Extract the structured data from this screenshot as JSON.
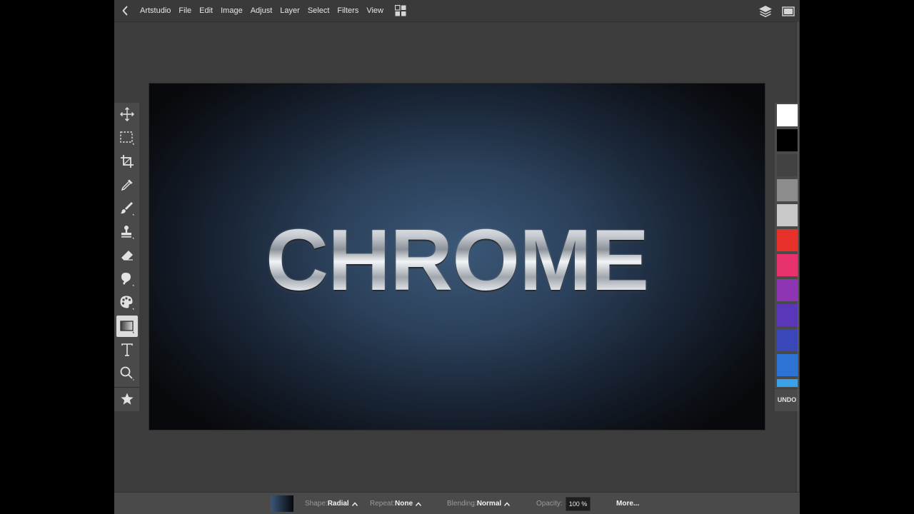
{
  "menubar": {
    "app_name": "Artstudio",
    "items": [
      "File",
      "Edit",
      "Image",
      "Adjust",
      "Layer",
      "Select",
      "Filters",
      "View"
    ],
    "icons": [
      "back-icon",
      "grid-icon",
      "layers-icon",
      "fullscreen-icon"
    ]
  },
  "toolbar": {
    "tools": [
      {
        "name": "move-tool",
        "icon": "move-icon"
      },
      {
        "name": "selection-tool",
        "icon": "marquee-icon"
      },
      {
        "name": "crop-tool",
        "icon": "crop-icon"
      },
      {
        "name": "eyedropper-tool",
        "icon": "eyedropper-icon"
      },
      {
        "name": "brush-tool",
        "icon": "brush-icon"
      },
      {
        "name": "stamp-tool",
        "icon": "stamp-icon"
      },
      {
        "name": "eraser-tool",
        "icon": "eraser-icon"
      },
      {
        "name": "smudge-tool",
        "icon": "smudge-icon"
      },
      {
        "name": "color-tool",
        "icon": "palette-icon"
      },
      {
        "name": "gradient-tool",
        "icon": "gradient-icon",
        "active": true
      },
      {
        "name": "text-tool",
        "icon": "text-icon"
      },
      {
        "name": "zoom-tool",
        "icon": "zoom-icon"
      },
      {
        "name": "favorites-tool",
        "icon": "star-icon"
      }
    ]
  },
  "canvas": {
    "text": "CHROME",
    "background_center": "#3b5878",
    "background_edge": "#08090c"
  },
  "palette": {
    "swatches": [
      "#ffffff",
      "#000000",
      "#424242",
      "#8c8c8c",
      "#c8c8c8",
      "#e8312a",
      "#e8326e",
      "#8e35b4",
      "#5a36b8",
      "#3a47b8",
      "#2e72d4",
      "#3aa0e8"
    ],
    "undo_label": "UNDO"
  },
  "bottombar": {
    "shape_label": "Shape:",
    "shape_value": "Radial",
    "repeat_label": "Repeat:",
    "repeat_value": "None",
    "blending_label": "Blending:",
    "blending_value": "Normal",
    "opacity_label": "Opacity:",
    "opacity_value": "100 %",
    "more_label": "More..."
  }
}
